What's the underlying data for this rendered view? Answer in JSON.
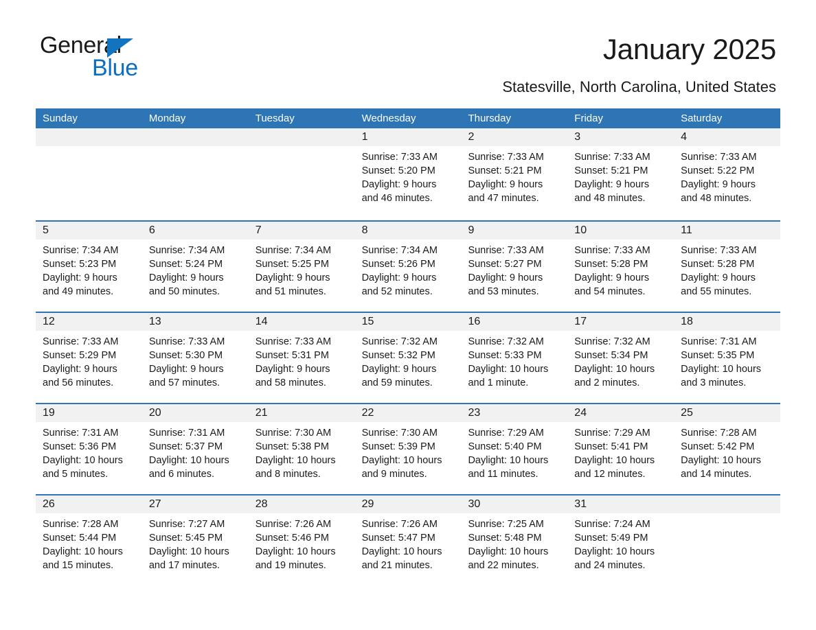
{
  "logo": {
    "word1": "General",
    "word2": "Blue",
    "triangle_color": "#1273BE",
    "blue_text_color": "#0D6EBF"
  },
  "header": {
    "title": "January 2025",
    "subtitle": "Statesville, North Carolina, United States",
    "accent_color": "#2E75B6",
    "day_band_color": "#F1F1F1"
  },
  "weekdays": [
    "Sunday",
    "Monday",
    "Tuesday",
    "Wednesday",
    "Thursday",
    "Friday",
    "Saturday"
  ],
  "weeks": [
    [
      {
        "day": "",
        "sunrise": "",
        "sunset": "",
        "daylight1": "",
        "daylight2": ""
      },
      {
        "day": "",
        "sunrise": "",
        "sunset": "",
        "daylight1": "",
        "daylight2": ""
      },
      {
        "day": "",
        "sunrise": "",
        "sunset": "",
        "daylight1": "",
        "daylight2": ""
      },
      {
        "day": "1",
        "sunrise": "Sunrise: 7:33 AM",
        "sunset": "Sunset: 5:20 PM",
        "daylight1": "Daylight: 9 hours",
        "daylight2": "and 46 minutes."
      },
      {
        "day": "2",
        "sunrise": "Sunrise: 7:33 AM",
        "sunset": "Sunset: 5:21 PM",
        "daylight1": "Daylight: 9 hours",
        "daylight2": "and 47 minutes."
      },
      {
        "day": "3",
        "sunrise": "Sunrise: 7:33 AM",
        "sunset": "Sunset: 5:21 PM",
        "daylight1": "Daylight: 9 hours",
        "daylight2": "and 48 minutes."
      },
      {
        "day": "4",
        "sunrise": "Sunrise: 7:33 AM",
        "sunset": "Sunset: 5:22 PM",
        "daylight1": "Daylight: 9 hours",
        "daylight2": "and 48 minutes."
      }
    ],
    [
      {
        "day": "5",
        "sunrise": "Sunrise: 7:34 AM",
        "sunset": "Sunset: 5:23 PM",
        "daylight1": "Daylight: 9 hours",
        "daylight2": "and 49 minutes."
      },
      {
        "day": "6",
        "sunrise": "Sunrise: 7:34 AM",
        "sunset": "Sunset: 5:24 PM",
        "daylight1": "Daylight: 9 hours",
        "daylight2": "and 50 minutes."
      },
      {
        "day": "7",
        "sunrise": "Sunrise: 7:34 AM",
        "sunset": "Sunset: 5:25 PM",
        "daylight1": "Daylight: 9 hours",
        "daylight2": "and 51 minutes."
      },
      {
        "day": "8",
        "sunrise": "Sunrise: 7:34 AM",
        "sunset": "Sunset: 5:26 PM",
        "daylight1": "Daylight: 9 hours",
        "daylight2": "and 52 minutes."
      },
      {
        "day": "9",
        "sunrise": "Sunrise: 7:33 AM",
        "sunset": "Sunset: 5:27 PM",
        "daylight1": "Daylight: 9 hours",
        "daylight2": "and 53 minutes."
      },
      {
        "day": "10",
        "sunrise": "Sunrise: 7:33 AM",
        "sunset": "Sunset: 5:28 PM",
        "daylight1": "Daylight: 9 hours",
        "daylight2": "and 54 minutes."
      },
      {
        "day": "11",
        "sunrise": "Sunrise: 7:33 AM",
        "sunset": "Sunset: 5:28 PM",
        "daylight1": "Daylight: 9 hours",
        "daylight2": "and 55 minutes."
      }
    ],
    [
      {
        "day": "12",
        "sunrise": "Sunrise: 7:33 AM",
        "sunset": "Sunset: 5:29 PM",
        "daylight1": "Daylight: 9 hours",
        "daylight2": "and 56 minutes."
      },
      {
        "day": "13",
        "sunrise": "Sunrise: 7:33 AM",
        "sunset": "Sunset: 5:30 PM",
        "daylight1": "Daylight: 9 hours",
        "daylight2": "and 57 minutes."
      },
      {
        "day": "14",
        "sunrise": "Sunrise: 7:33 AM",
        "sunset": "Sunset: 5:31 PM",
        "daylight1": "Daylight: 9 hours",
        "daylight2": "and 58 minutes."
      },
      {
        "day": "15",
        "sunrise": "Sunrise: 7:32 AM",
        "sunset": "Sunset: 5:32 PM",
        "daylight1": "Daylight: 9 hours",
        "daylight2": "and 59 minutes."
      },
      {
        "day": "16",
        "sunrise": "Sunrise: 7:32 AM",
        "sunset": "Sunset: 5:33 PM",
        "daylight1": "Daylight: 10 hours",
        "daylight2": "and 1 minute."
      },
      {
        "day": "17",
        "sunrise": "Sunrise: 7:32 AM",
        "sunset": "Sunset: 5:34 PM",
        "daylight1": "Daylight: 10 hours",
        "daylight2": "and 2 minutes."
      },
      {
        "day": "18",
        "sunrise": "Sunrise: 7:31 AM",
        "sunset": "Sunset: 5:35 PM",
        "daylight1": "Daylight: 10 hours",
        "daylight2": "and 3 minutes."
      }
    ],
    [
      {
        "day": "19",
        "sunrise": "Sunrise: 7:31 AM",
        "sunset": "Sunset: 5:36 PM",
        "daylight1": "Daylight: 10 hours",
        "daylight2": "and 5 minutes."
      },
      {
        "day": "20",
        "sunrise": "Sunrise: 7:31 AM",
        "sunset": "Sunset: 5:37 PM",
        "daylight1": "Daylight: 10 hours",
        "daylight2": "and 6 minutes."
      },
      {
        "day": "21",
        "sunrise": "Sunrise: 7:30 AM",
        "sunset": "Sunset: 5:38 PM",
        "daylight1": "Daylight: 10 hours",
        "daylight2": "and 8 minutes."
      },
      {
        "day": "22",
        "sunrise": "Sunrise: 7:30 AM",
        "sunset": "Sunset: 5:39 PM",
        "daylight1": "Daylight: 10 hours",
        "daylight2": "and 9 minutes."
      },
      {
        "day": "23",
        "sunrise": "Sunrise: 7:29 AM",
        "sunset": "Sunset: 5:40 PM",
        "daylight1": "Daylight: 10 hours",
        "daylight2": "and 11 minutes."
      },
      {
        "day": "24",
        "sunrise": "Sunrise: 7:29 AM",
        "sunset": "Sunset: 5:41 PM",
        "daylight1": "Daylight: 10 hours",
        "daylight2": "and 12 minutes."
      },
      {
        "day": "25",
        "sunrise": "Sunrise: 7:28 AM",
        "sunset": "Sunset: 5:42 PM",
        "daylight1": "Daylight: 10 hours",
        "daylight2": "and 14 minutes."
      }
    ],
    [
      {
        "day": "26",
        "sunrise": "Sunrise: 7:28 AM",
        "sunset": "Sunset: 5:44 PM",
        "daylight1": "Daylight: 10 hours",
        "daylight2": "and 15 minutes."
      },
      {
        "day": "27",
        "sunrise": "Sunrise: 7:27 AM",
        "sunset": "Sunset: 5:45 PM",
        "daylight1": "Daylight: 10 hours",
        "daylight2": "and 17 minutes."
      },
      {
        "day": "28",
        "sunrise": "Sunrise: 7:26 AM",
        "sunset": "Sunset: 5:46 PM",
        "daylight1": "Daylight: 10 hours",
        "daylight2": "and 19 minutes."
      },
      {
        "day": "29",
        "sunrise": "Sunrise: 7:26 AM",
        "sunset": "Sunset: 5:47 PM",
        "daylight1": "Daylight: 10 hours",
        "daylight2": "and 21 minutes."
      },
      {
        "day": "30",
        "sunrise": "Sunrise: 7:25 AM",
        "sunset": "Sunset: 5:48 PM",
        "daylight1": "Daylight: 10 hours",
        "daylight2": "and 22 minutes."
      },
      {
        "day": "31",
        "sunrise": "Sunrise: 7:24 AM",
        "sunset": "Sunset: 5:49 PM",
        "daylight1": "Daylight: 10 hours",
        "daylight2": "and 24 minutes."
      },
      {
        "day": "",
        "sunrise": "",
        "sunset": "",
        "daylight1": "",
        "daylight2": ""
      }
    ]
  ]
}
